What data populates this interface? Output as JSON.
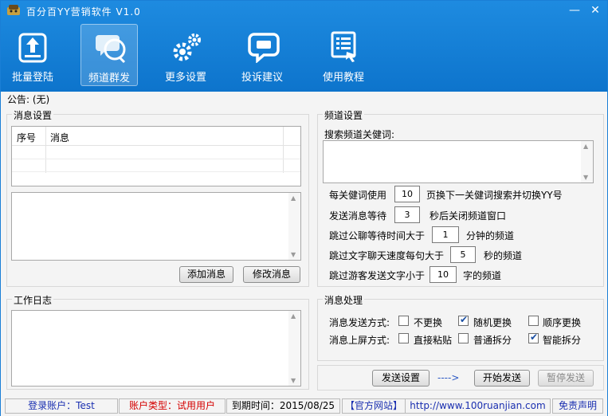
{
  "window": {
    "title": "百分百YY营销软件 V1.0",
    "minimize": "—",
    "close": "✕"
  },
  "toolbar": {
    "items": [
      {
        "label": "批量登陆",
        "icon": "upload-box-icon"
      },
      {
        "label": "频道群发",
        "icon": "chat-bubbles-icon",
        "active": true
      },
      {
        "label": "更多设置",
        "icon": "gears-icon"
      },
      {
        "label": "投诉建议",
        "icon": "feedback-bubble-icon"
      },
      {
        "label": "使用教程",
        "icon": "tutorial-icon"
      }
    ]
  },
  "notice": "公告: (无)",
  "message_settings": {
    "title": "消息设置",
    "columns": [
      "序号",
      "消息"
    ],
    "rows": [],
    "add_button": "添加消息",
    "edit_button": "修改消息"
  },
  "work_log": {
    "title": "工作日志"
  },
  "channel_settings": {
    "title": "频道设置",
    "keyword_label": "搜索频道关健词:",
    "row1": {
      "prefix": "每关健词使用",
      "value": "10",
      "suffix": "页换下一关健词搜索并切换YY号"
    },
    "row2": {
      "prefix": "发送消息等待",
      "value": "3",
      "suffix": "秒后关闭频道窗口"
    },
    "row3": {
      "prefix": "跳过公聊等待时间大于",
      "value": "1",
      "suffix": "分钟的频道"
    },
    "row4": {
      "prefix": "跳过文字聊天速度每句大于",
      "value": "5",
      "suffix": "秒的频道"
    },
    "row5": {
      "prefix": "跳过游客发送文字小于",
      "value": "10",
      "suffix": "字的频道"
    }
  },
  "message_processing": {
    "title": "消息处理",
    "send_mode_label": "消息发送方式:",
    "send_modes": [
      {
        "label": "不更换",
        "checked": false
      },
      {
        "label": "随机更换",
        "checked": true
      },
      {
        "label": "顺序更换",
        "checked": false
      }
    ],
    "screen_mode_label": "消息上屏方式:",
    "screen_modes": [
      {
        "label": "直接粘贴",
        "checked": false
      },
      {
        "label": "普通拆分",
        "checked": false
      },
      {
        "label": "智能拆分",
        "checked": true
      }
    ]
  },
  "actions": {
    "send_settings": "发送设置",
    "arrow": "---->",
    "start": "开始发送",
    "pause": "暂停发送"
  },
  "status": {
    "account": "登录账户：Test",
    "account_type": "账户类型：试用用户",
    "expiry": "到期时间：2015/08/25",
    "site_tag": "【官方网站】",
    "site_url": "http://www.100ruanjian.com",
    "disclaimer": "免责声明"
  },
  "colors": {
    "header_blue": "#1e8be0",
    "account_type_red": "#d40000",
    "link_blue": "#1a2fb0"
  }
}
